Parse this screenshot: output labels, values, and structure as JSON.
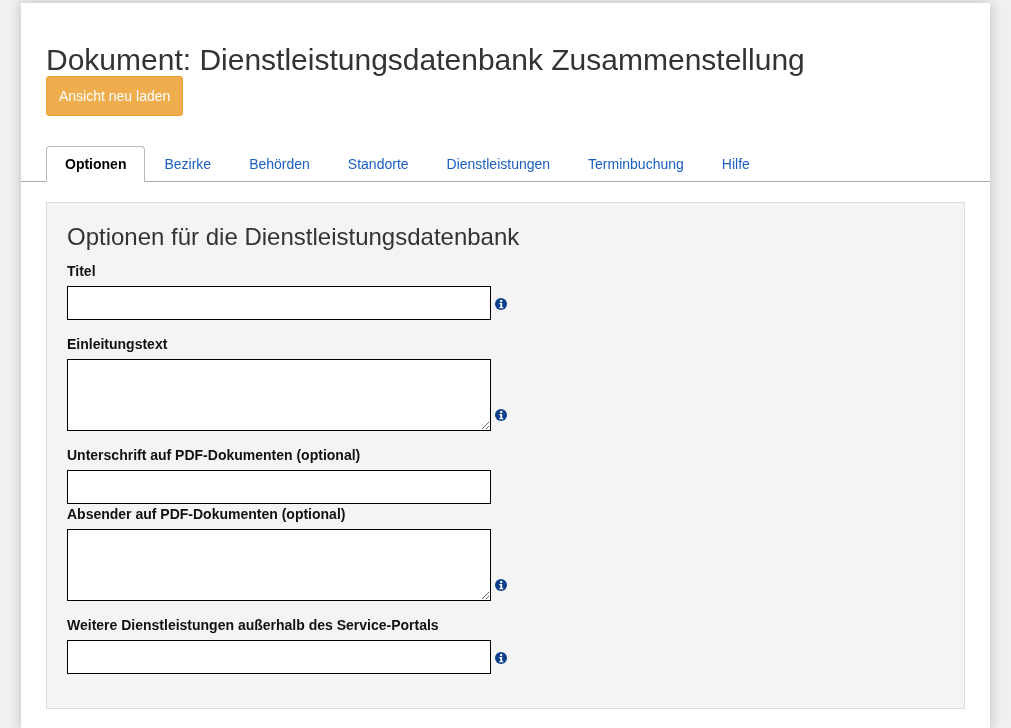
{
  "page": {
    "title": "Dokument: Dienstleistungsdatenbank Zusammenstellung",
    "reload_button": "Ansicht neu laden"
  },
  "tabs": [
    {
      "label": "Optionen",
      "selected": true
    },
    {
      "label": "Bezirke",
      "selected": false
    },
    {
      "label": "Behörden",
      "selected": false
    },
    {
      "label": "Standorte",
      "selected": false
    },
    {
      "label": "Dienstleistungen",
      "selected": false
    },
    {
      "label": "Terminbuchung",
      "selected": false
    },
    {
      "label": "Hilfe",
      "selected": false
    }
  ],
  "panel": {
    "heading": "Optionen für die Dienstleistungsdatenbank",
    "fields": [
      {
        "kind": "input",
        "label": "Titel",
        "info": true
      },
      {
        "kind": "textarea",
        "label": "Einleitungstext",
        "info": true
      },
      {
        "kind": "input",
        "label": "Unterschrift auf PDF-Dokumenten (optional)",
        "info": false
      },
      {
        "kind": "textarea",
        "label": "Absender auf PDF-Dokumenten (optional)",
        "info": true
      },
      {
        "kind": "input",
        "label": "Weitere Dienstleistungen außerhalb des Service-Portals",
        "info": true
      }
    ]
  }
}
